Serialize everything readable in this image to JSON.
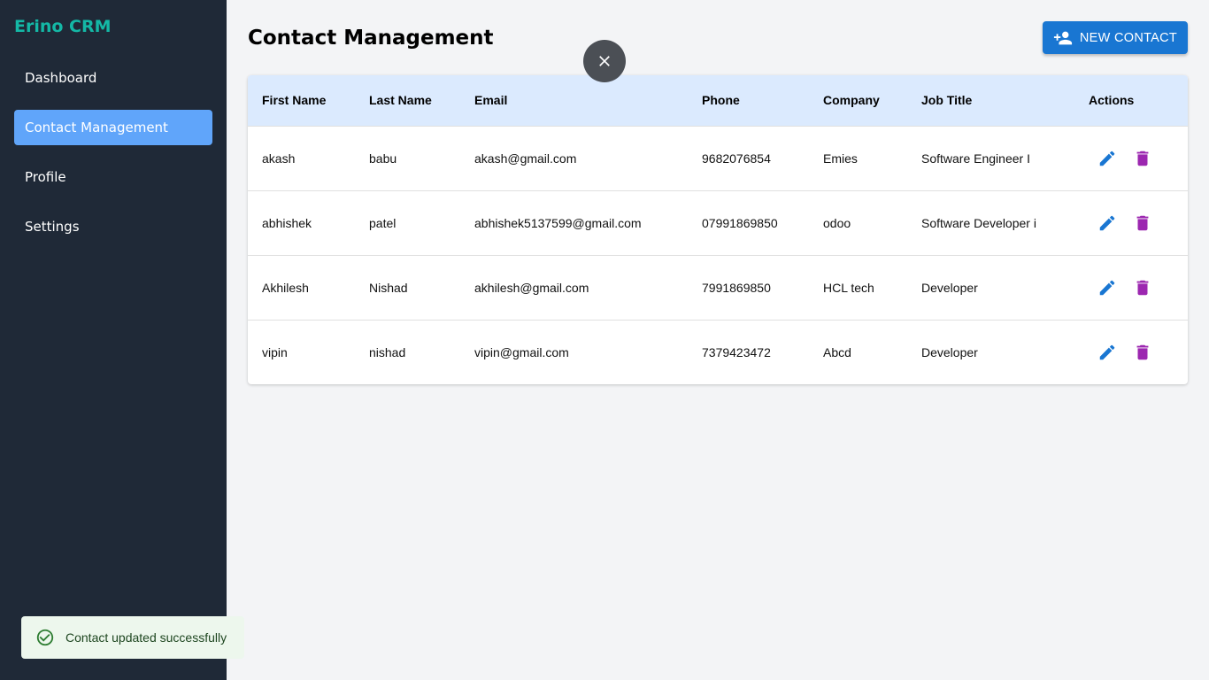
{
  "app": {
    "brand": "Erino CRM"
  },
  "sidebar": {
    "items": [
      {
        "label": "Dashboard",
        "active": false
      },
      {
        "label": "Contact Management",
        "active": true
      },
      {
        "label": "Profile",
        "active": false
      },
      {
        "label": "Settings",
        "active": false
      }
    ]
  },
  "header": {
    "title": "Contact Management",
    "new_contact_label": "NEW CONTACT",
    "new_contact_icon": "person-add-icon"
  },
  "overlay": {
    "close_icon": "close-icon"
  },
  "table": {
    "columns": [
      "First Name",
      "Last Name",
      "Email",
      "Phone",
      "Company",
      "Job Title",
      "Actions"
    ],
    "rows": [
      {
        "first": "akash",
        "last": "babu",
        "email": "akash@gmail.com",
        "phone": "9682076854",
        "company": "Emies",
        "job": "Software Engineer I"
      },
      {
        "first": "abhishek",
        "last": "patel",
        "email": "abhishek5137599@gmail.com",
        "phone": "07991869850",
        "company": "odoo",
        "job": "Software Developer i"
      },
      {
        "first": "Akhilesh",
        "last": "Nishad",
        "email": "akhilesh@gmail.com",
        "phone": "7991869850",
        "company": "HCL tech",
        "job": "Developer"
      },
      {
        "first": "vipin",
        "last": "nishad",
        "email": "vipin@gmail.com",
        "phone": "7379423472",
        "company": "Abcd",
        "job": "Developer"
      }
    ],
    "edit_icon": "pencil-icon",
    "delete_icon": "trash-icon"
  },
  "toast": {
    "message": "Contact updated successfully",
    "icon": "check-circle-icon"
  },
  "colors": {
    "sidebar_bg": "#1f2937",
    "brand": "#14b8a6",
    "active_nav": "#60a5fa",
    "primary": "#1976d2",
    "delete": "#9c27b0",
    "table_header": "#dbeafe",
    "toast_bg": "#edf7ed",
    "toast_icon": "#2e7d32"
  }
}
